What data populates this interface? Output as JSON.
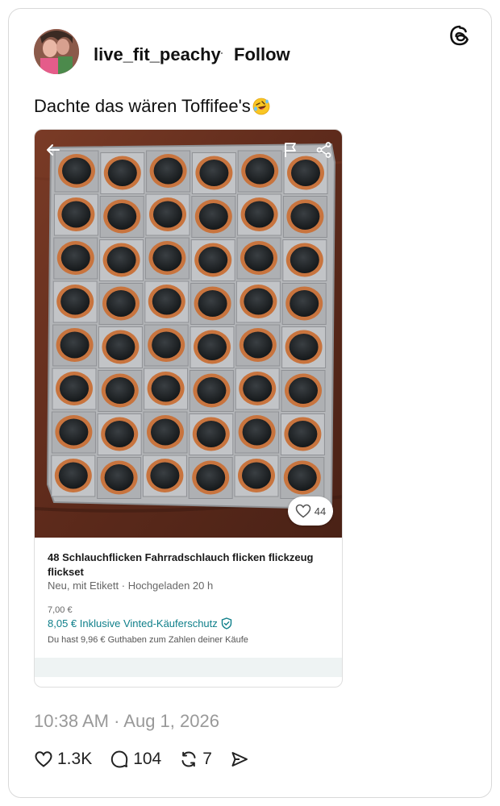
{
  "post": {
    "username": "live_fit_peachy",
    "separator": "·",
    "follow_label": "Follow",
    "text": "Dachte das wären Toffifee's",
    "timestamp": "10:38 AM · Aug 1, 2026"
  },
  "listing": {
    "title": "48 Schlauchflicken Fahrradschlauch flicken flickzeug flickset",
    "meta": "Neu, mit Etikett · Hochgeladen 20 h",
    "price": "7,00 €",
    "total_price": "8,05 € Inklusive Vinted-Käuferschutz",
    "credit_note": "Du hast 9,96 € Guthaben zum Zahlen deiner Käufe",
    "favorites": "44"
  },
  "actions": {
    "likes": "1.3K",
    "replies": "104",
    "reposts": "7"
  },
  "colors": {
    "accent_teal": "#0f7f8a",
    "patch_orange": "#c8743e",
    "patch_black": "#1f2326",
    "table_wood": "#6b3322",
    "foil": "#b9bbbd"
  },
  "icons": [
    "threads-logo-icon",
    "back-arrow-icon",
    "flag-icon",
    "share-icon",
    "heart-icon",
    "reply-icon",
    "repost-icon",
    "send-icon",
    "shield-check-icon",
    "rofl-emoji"
  ]
}
